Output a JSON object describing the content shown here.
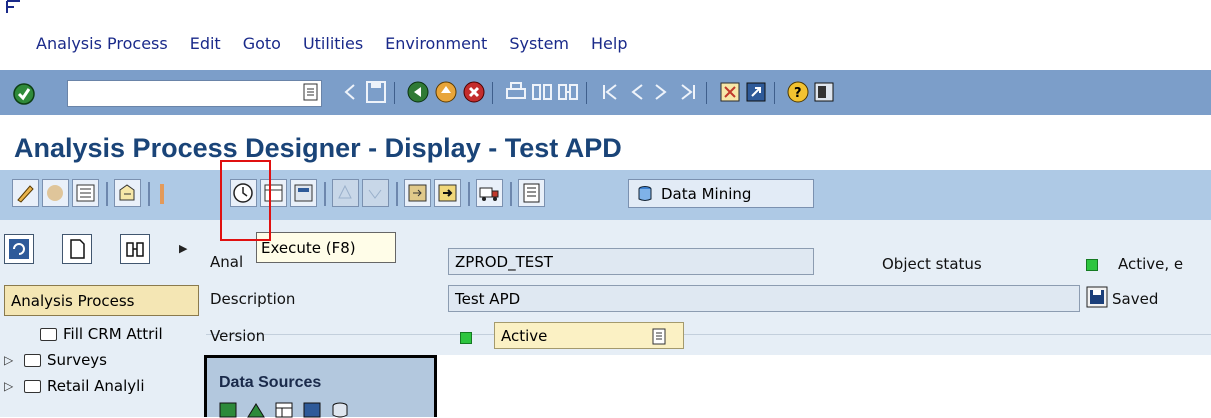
{
  "menu": {
    "items": [
      "Analysis Process",
      "Edit",
      "Goto",
      "Utilities",
      "Environment",
      "System",
      "Help"
    ]
  },
  "title": "Analysis Process Designer - Display - Test APD",
  "app_toolbar": {
    "data_mining_label": "Data Mining"
  },
  "tooltip": "Execute  (F8)",
  "nav": {
    "header": "Analysis Process",
    "items": [
      "Fill CRM Attril",
      "Surveys",
      "Retail Analyli"
    ]
  },
  "form": {
    "analysis_label": "Anal",
    "analysis_value": "ZPROD_TEST",
    "object_status_label": "Object status",
    "object_status_value": "Active, e",
    "description_label": "Description",
    "description_value": "Test APD",
    "saved_label": "Saved",
    "version_label": "Version",
    "version_value": "Active"
  },
  "data_sources": {
    "title": "Data Sources"
  },
  "colors": {
    "std_toolbar": "#7c9ec9",
    "app_toolbar": "#aec9e5",
    "title": "#1a4478",
    "highlight": "#e01010",
    "status_green": "#2dc53f"
  }
}
